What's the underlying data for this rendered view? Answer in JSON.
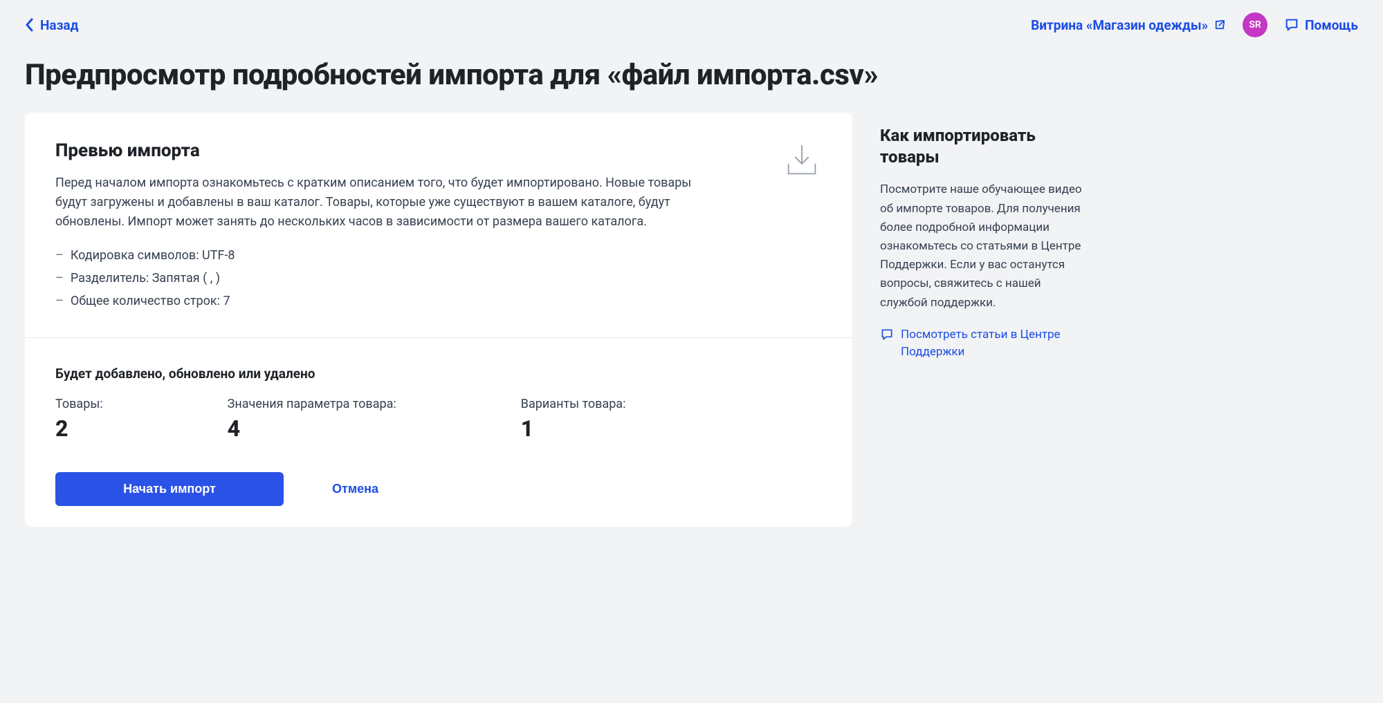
{
  "header": {
    "back_label": "Назад",
    "vitrina_label": "Витрина «Магазин одежды»",
    "avatar_initials": "SR",
    "help_label": "Помощь"
  },
  "page_title": "Предпросмотр подробностей импорта для «файл импорта.csv»",
  "preview_card": {
    "title": "Превью импорта",
    "description": "Перед началом импорта ознакомьтесь с кратким описанием того, что будет импортировано. Новые товары будут загружены и добавлены в ваш каталог. Товары, которые уже существуют в вашем каталоге, будут обновлены. Импорт может занять до нескольких часов в зависимости от размера вашего каталога.",
    "details": [
      "Кодировка символов: UTF-8",
      "Разделитель: Запятая ( , )",
      "Общее количество строк: 7"
    ]
  },
  "summary": {
    "heading": "Будет добавлено, обновлено или удалено",
    "stats": [
      {
        "label": "Товары:",
        "value": "2"
      },
      {
        "label": "Значения параметра товара:",
        "value": "4"
      },
      {
        "label": "Варианты товара:",
        "value": "1"
      }
    ],
    "start_button": "Начать импорт",
    "cancel_button": "Отмена"
  },
  "sidebar": {
    "title": "Как импортировать товары",
    "text": "Посмотрите наше обучающее видео об импорте товаров. Для получения более подробной информации ознакомьтесь со статьями в Центре Поддержки. Если у вас останутся вопросы, свяжитесь с нашей службой поддержки.",
    "link_label": "Посмотреть статьи в Центре Поддержки"
  }
}
